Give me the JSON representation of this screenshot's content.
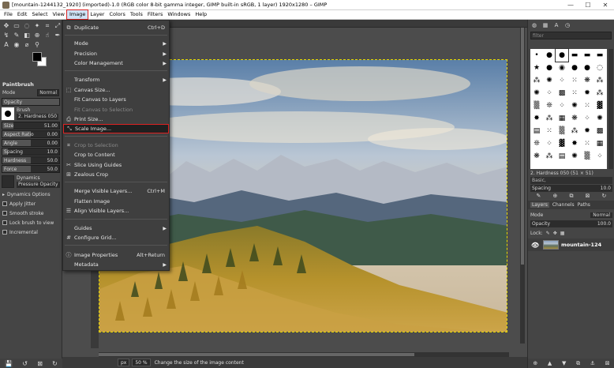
{
  "window": {
    "title": "[mountain-1244132_1920] (imported)-1.0 (RGB color 8-bit gamma integer, GIMP built-in sRGB, 1 layer) 1920x1280 – GIMP",
    "minimize": "—",
    "maximize": "☐",
    "close": "✕"
  },
  "menubar": [
    "File",
    "Edit",
    "Select",
    "View",
    "Image",
    "Layer",
    "Colors",
    "Tools",
    "Filters",
    "Windows",
    "Help"
  ],
  "image_menu": {
    "duplicate": {
      "label": "Duplicate",
      "shortcut": "Ctrl+D"
    },
    "mode": "Mode",
    "precision": "Precision",
    "color_management": "Color Management",
    "transform": "Transform",
    "canvas_size": "Canvas Size...",
    "fit_canvas_layers": "Fit Canvas to Layers",
    "fit_canvas_selection": "Fit Canvas to Selection",
    "print_size": "Print Size...",
    "scale_image": "Scale Image...",
    "crop_selection": "Crop to Selection",
    "crop_content": "Crop to Content",
    "slice_guides": "Slice Using Guides",
    "zealous_crop": "Zealous Crop",
    "merge_visible": {
      "label": "Merge Visible Layers...",
      "shortcut": "Ctrl+M"
    },
    "flatten": "Flatten Image",
    "align_visible": "Align Visible Layers...",
    "guides": "Guides",
    "configure_grid": "Configure Grid...",
    "image_properties": {
      "label": "Image Properties",
      "shortcut": "Alt+Return"
    },
    "metadata": "Metadata"
  },
  "tool_options": {
    "title": "Paintbrush",
    "mode_label": "Mode",
    "mode_value": "Normal",
    "opacity_label": "Opacity",
    "brush_label": "Brush",
    "brush_name": "2. Hardness 050",
    "size_label": "Size",
    "size_value": "51.00",
    "aspect_label": "Aspect Ratio",
    "aspect_value": "0.00",
    "angle_label": "Angle",
    "angle_value": "0.00",
    "spacing_label": "Spacing",
    "spacing_value": "10.0",
    "hardness_label": "Hardness",
    "hardness_value": "50.0",
    "force_label": "Force",
    "force_value": "50.0",
    "dynamics_label": "Dynamics",
    "dynamics_name": "Pressure Opacity",
    "dynamics_options": "Dynamics Options",
    "apply_jitter": "Apply Jitter",
    "smooth_stroke": "Smooth stroke",
    "lock_brush": "Lock brush to view",
    "incremental": "Incremental"
  },
  "status": {
    "unit": "px",
    "zoom": "50 %",
    "message": "Change the size of the image content"
  },
  "dock": {
    "filter_placeholder": "filter",
    "brush_name": "2. Hardness 050 (51 × 51)",
    "tag": "Basic,",
    "spacing_label": "Spacing",
    "spacing_value": "10.0",
    "layers_tab": "Layers",
    "channels_tab": "Channels",
    "paths_tab": "Paths",
    "mode_label": "Mode",
    "mode_value": "Normal",
    "opacity_label": "Opacity",
    "opacity_value": "100.0",
    "lock_label": "Lock:",
    "layer_name": "mountain-124"
  },
  "colors": {
    "highlight_outline": "#dd2222",
    "selection_border": "#e6d800"
  }
}
